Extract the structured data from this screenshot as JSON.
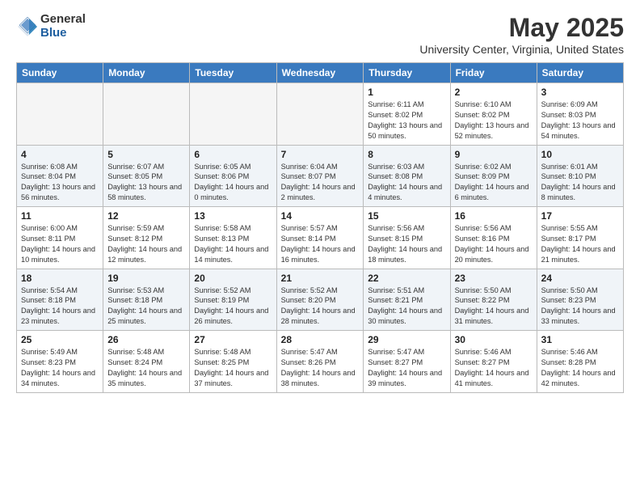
{
  "logo": {
    "general": "General",
    "blue": "Blue"
  },
  "header": {
    "month": "May 2025",
    "location": "University Center, Virginia, United States"
  },
  "days_of_week": [
    "Sunday",
    "Monday",
    "Tuesday",
    "Wednesday",
    "Thursday",
    "Friday",
    "Saturday"
  ],
  "weeks": [
    [
      {
        "day": "",
        "empty": true
      },
      {
        "day": "",
        "empty": true
      },
      {
        "day": "",
        "empty": true
      },
      {
        "day": "",
        "empty": true
      },
      {
        "day": "1",
        "sunrise": "6:11 AM",
        "sunset": "8:02 PM",
        "daylight": "13 hours and 50 minutes."
      },
      {
        "day": "2",
        "sunrise": "6:10 AM",
        "sunset": "8:02 PM",
        "daylight": "13 hours and 52 minutes."
      },
      {
        "day": "3",
        "sunrise": "6:09 AM",
        "sunset": "8:03 PM",
        "daylight": "13 hours and 54 minutes."
      }
    ],
    [
      {
        "day": "4",
        "sunrise": "6:08 AM",
        "sunset": "8:04 PM",
        "daylight": "13 hours and 56 minutes."
      },
      {
        "day": "5",
        "sunrise": "6:07 AM",
        "sunset": "8:05 PM",
        "daylight": "13 hours and 58 minutes."
      },
      {
        "day": "6",
        "sunrise": "6:05 AM",
        "sunset": "8:06 PM",
        "daylight": "14 hours and 0 minutes."
      },
      {
        "day": "7",
        "sunrise": "6:04 AM",
        "sunset": "8:07 PM",
        "daylight": "14 hours and 2 minutes."
      },
      {
        "day": "8",
        "sunrise": "6:03 AM",
        "sunset": "8:08 PM",
        "daylight": "14 hours and 4 minutes."
      },
      {
        "day": "9",
        "sunrise": "6:02 AM",
        "sunset": "8:09 PM",
        "daylight": "14 hours and 6 minutes."
      },
      {
        "day": "10",
        "sunrise": "6:01 AM",
        "sunset": "8:10 PM",
        "daylight": "14 hours and 8 minutes."
      }
    ],
    [
      {
        "day": "11",
        "sunrise": "6:00 AM",
        "sunset": "8:11 PM",
        "daylight": "14 hours and 10 minutes."
      },
      {
        "day": "12",
        "sunrise": "5:59 AM",
        "sunset": "8:12 PM",
        "daylight": "14 hours and 12 minutes."
      },
      {
        "day": "13",
        "sunrise": "5:58 AM",
        "sunset": "8:13 PM",
        "daylight": "14 hours and 14 minutes."
      },
      {
        "day": "14",
        "sunrise": "5:57 AM",
        "sunset": "8:14 PM",
        "daylight": "14 hours and 16 minutes."
      },
      {
        "day": "15",
        "sunrise": "5:56 AM",
        "sunset": "8:15 PM",
        "daylight": "14 hours and 18 minutes."
      },
      {
        "day": "16",
        "sunrise": "5:56 AM",
        "sunset": "8:16 PM",
        "daylight": "14 hours and 20 minutes."
      },
      {
        "day": "17",
        "sunrise": "5:55 AM",
        "sunset": "8:17 PM",
        "daylight": "14 hours and 21 minutes."
      }
    ],
    [
      {
        "day": "18",
        "sunrise": "5:54 AM",
        "sunset": "8:18 PM",
        "daylight": "14 hours and 23 minutes."
      },
      {
        "day": "19",
        "sunrise": "5:53 AM",
        "sunset": "8:18 PM",
        "daylight": "14 hours and 25 minutes."
      },
      {
        "day": "20",
        "sunrise": "5:52 AM",
        "sunset": "8:19 PM",
        "daylight": "14 hours and 26 minutes."
      },
      {
        "day": "21",
        "sunrise": "5:52 AM",
        "sunset": "8:20 PM",
        "daylight": "14 hours and 28 minutes."
      },
      {
        "day": "22",
        "sunrise": "5:51 AM",
        "sunset": "8:21 PM",
        "daylight": "14 hours and 30 minutes."
      },
      {
        "day": "23",
        "sunrise": "5:50 AM",
        "sunset": "8:22 PM",
        "daylight": "14 hours and 31 minutes."
      },
      {
        "day": "24",
        "sunrise": "5:50 AM",
        "sunset": "8:23 PM",
        "daylight": "14 hours and 33 minutes."
      }
    ],
    [
      {
        "day": "25",
        "sunrise": "5:49 AM",
        "sunset": "8:23 PM",
        "daylight": "14 hours and 34 minutes."
      },
      {
        "day": "26",
        "sunrise": "5:48 AM",
        "sunset": "8:24 PM",
        "daylight": "14 hours and 35 minutes."
      },
      {
        "day": "27",
        "sunrise": "5:48 AM",
        "sunset": "8:25 PM",
        "daylight": "14 hours and 37 minutes."
      },
      {
        "day": "28",
        "sunrise": "5:47 AM",
        "sunset": "8:26 PM",
        "daylight": "14 hours and 38 minutes."
      },
      {
        "day": "29",
        "sunrise": "5:47 AM",
        "sunset": "8:27 PM",
        "daylight": "14 hours and 39 minutes."
      },
      {
        "day": "30",
        "sunrise": "5:46 AM",
        "sunset": "8:27 PM",
        "daylight": "14 hours and 41 minutes."
      },
      {
        "day": "31",
        "sunrise": "5:46 AM",
        "sunset": "8:28 PM",
        "daylight": "14 hours and 42 minutes."
      }
    ]
  ],
  "labels": {
    "sunrise": "Sunrise:",
    "sunset": "Sunset:",
    "daylight": "Daylight:"
  }
}
